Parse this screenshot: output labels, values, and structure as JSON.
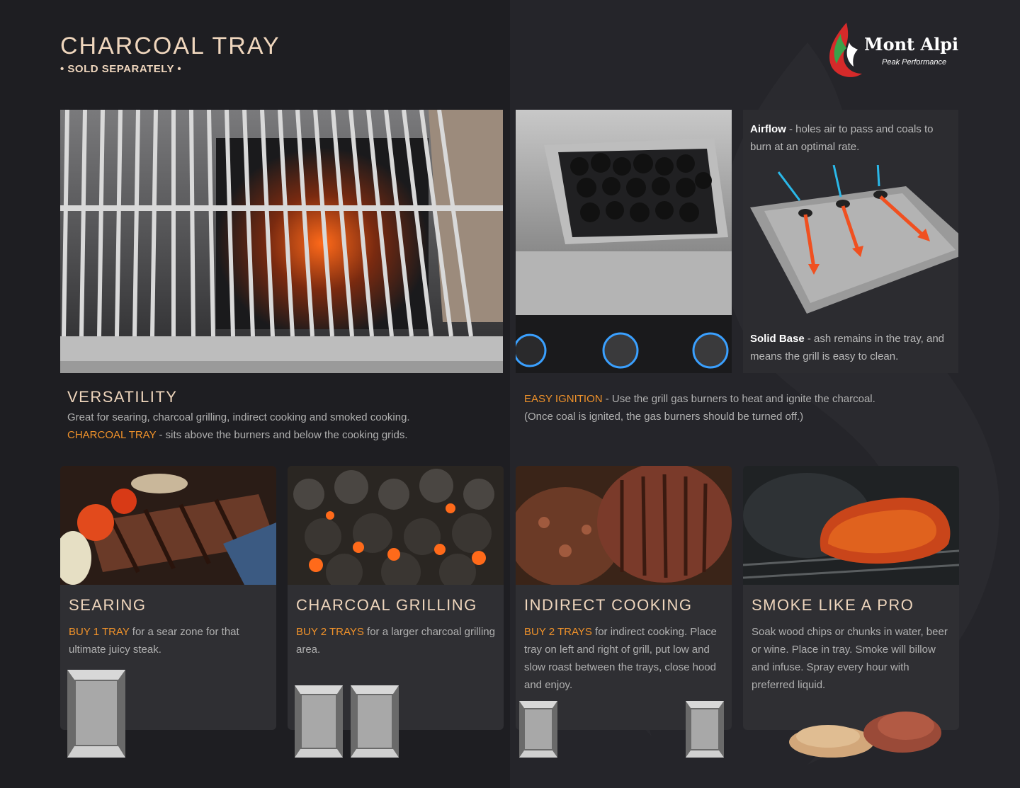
{
  "header": {
    "title": "CHARCOAL TRAY",
    "subtitle": "• SOLD SEPARATELY •"
  },
  "logo": {
    "name": "Mont Alpi",
    "tagline": "Peak Performance"
  },
  "airflow": {
    "label": "Airflow",
    "text": " - holes air to pass and coals to burn at an optimal rate."
  },
  "solid_base": {
    "label": "Solid Base",
    "text": " - ash remains in the tray, and means the grill is easy to clean."
  },
  "versatility": {
    "heading": "VERSATILITY",
    "line1": "Great for searing, charcoal grilling, indirect cooking and smoked cooking.",
    "highlight": "CHARCOAL TRAY",
    "line2": " - sits above the burners and below the cooking grids."
  },
  "easy_ignition": {
    "highlight": "EASY IGNITION",
    "text": " - Use the grill gas burners to heat and ignite the charcoal.",
    "line2": "(Once coal is ignited, the gas burners should be turned off.)"
  },
  "cards": [
    {
      "heading": "SEARING",
      "highlight": "BUY 1 TRAY",
      "text": " for a sear zone for that ultimate juicy steak."
    },
    {
      "heading": "CHARCOAL GRILLING",
      "highlight": "BUY 2 TRAYS",
      "text": " for a larger charcoal grilling area."
    },
    {
      "heading": "INDIRECT COOKING",
      "highlight": "BUY 2 TRAYS",
      "text": " for indirect cooking. Place tray on left and right of grill, put low and slow roast between the trays, close hood and enjoy."
    },
    {
      "heading": "SMOKE LIKE A PRO",
      "highlight": "",
      "text": "Soak wood chips or chunks in water, beer or wine. Place in tray. Smoke will billow and infuse. Spray every hour with preferred liquid."
    }
  ],
  "colors": {
    "accent": "#f0922a",
    "heading": "#efd6bd",
    "background": "#1e1e22",
    "card": "#2f2f33"
  }
}
